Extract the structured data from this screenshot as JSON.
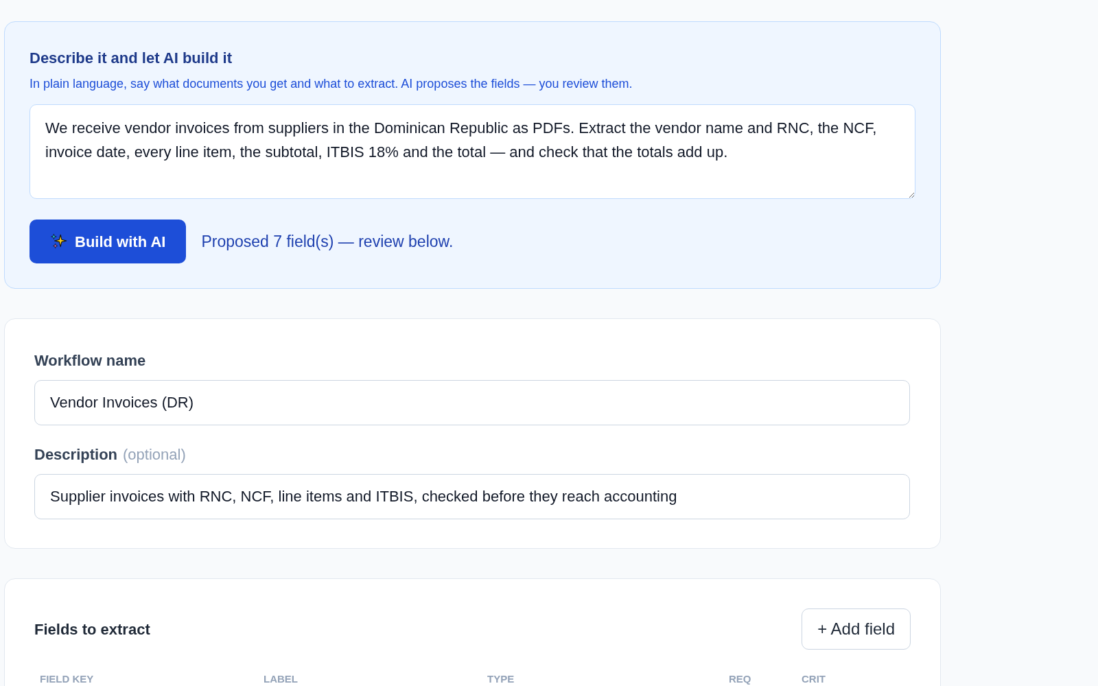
{
  "ai_panel": {
    "title": "Describe it and let AI build it",
    "subtitle": "In plain language, say what documents you get and what to extract. AI proposes the fields — you review them.",
    "prompt": {
      "value": "We receive vendor invoices from suppliers in the Dominican Republic as PDFs. Extract the vendor name and RNC, the NCF, invoice date, every line item, the subtotal, ITBIS 18% and the total — and check that the totals add up."
    },
    "build_button": "Build with AI",
    "status": "Proposed 7 field(s) — review below."
  },
  "details": {
    "fields": [
      {
        "label": "Workflow name",
        "value": "Vendor Invoices (DR)"
      },
      {
        "label": "Description",
        "hint": "(optional)",
        "value": "Supplier invoices with RNC, NCF, line items and ITBIS, checked before they reach accounting"
      }
    ]
  },
  "fields_card": {
    "title": "Fields to extract",
    "add_button": "+ Add field",
    "columns": [
      "FIELD KEY",
      "LABEL",
      "TYPE",
      "REQ",
      "CRIT"
    ]
  }
}
